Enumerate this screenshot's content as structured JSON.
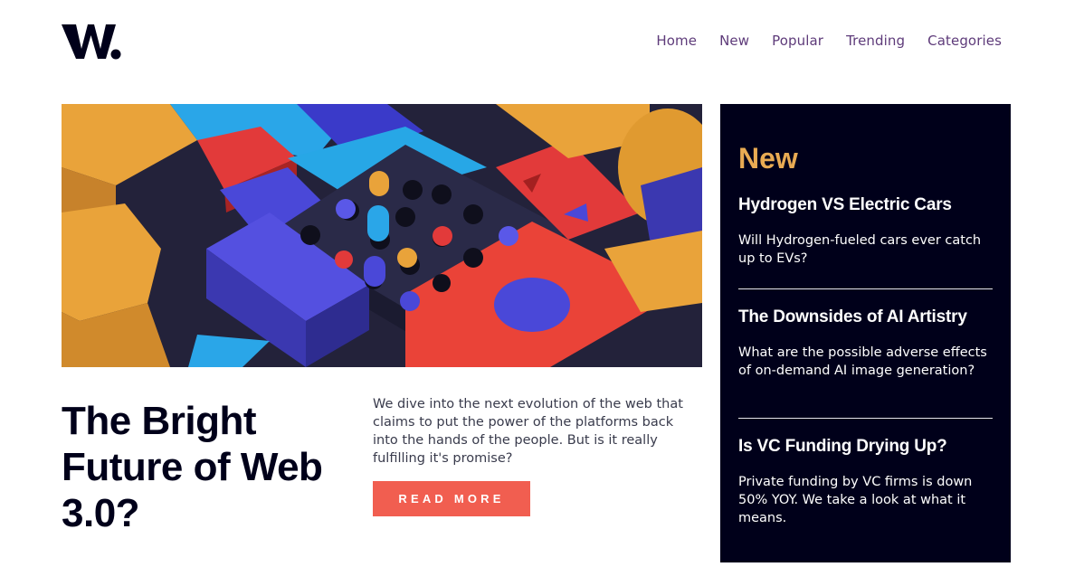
{
  "brand": {
    "logo_text": "W.",
    "logo_color": "#00001a"
  },
  "nav": {
    "items": [
      "Home",
      "New",
      "Popular",
      "Trending",
      "Categories"
    ]
  },
  "hero": {
    "image": "abstract-3d-blocks-illustration"
  },
  "article": {
    "title": "The Bright Future of Web 3.0?",
    "summary": "We dive into the next evolution of the web that claims to put the power of the platforms back into the hands of the people. But is it really fulfilling it's promise?",
    "cta_label": "READ MORE"
  },
  "sidebar": {
    "heading": "New",
    "items": [
      {
        "title": "Hydrogen VS Electric Cars",
        "description": "Will Hydrogen-fueled cars ever catch up to EVs?"
      },
      {
        "title": "The Downsides of AI Artistry",
        "description": "What are the possible adverse effects of on-demand AI image generation?"
      },
      {
        "title": "Is VC Funding Drying Up?",
        "description": "Private funding by VC firms is down 50% YOY. We take a look at what it means."
      }
    ]
  },
  "colors": {
    "accent_orange": "#e9ab53",
    "cta_red": "#f15e50",
    "dark_blue": "#00001a",
    "nav_purple": "#5e3b7a"
  }
}
